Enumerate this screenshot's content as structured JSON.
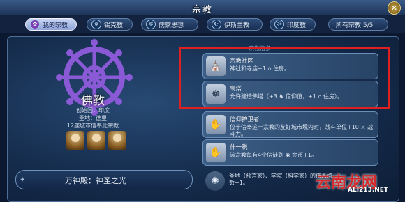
{
  "window": {
    "title": "宗教",
    "close_glyph": "✕"
  },
  "tabs": [
    {
      "label": "我的宗教",
      "icon": "lotus-icon",
      "glyph": "✿"
    },
    {
      "label": "锡克教",
      "icon": "khanda-icon",
      "glyph": "☬"
    },
    {
      "label": "儒家思想",
      "icon": "tree-icon",
      "glyph": "✲"
    },
    {
      "label": "伊斯兰教",
      "icon": "crescent-icon",
      "glyph": "☪"
    },
    {
      "label": "印度教",
      "icon": "om-icon",
      "glyph": "ॐ"
    },
    {
      "label": "所有宗教 5/5",
      "icon": "",
      "glyph": ""
    }
  ],
  "religion": {
    "name": "佛教",
    "founder": "创始国：印度",
    "holy_city": "圣地：德里",
    "cities_count": "12座城市信奉此宗教"
  },
  "beliefs_header": "宗教信条",
  "beliefs": [
    {
      "name": "宗教社区",
      "desc": "神社和寺庙+1 ⌂ 住房。",
      "glyph": "⛪"
    },
    {
      "name": "宝塔",
      "desc": "允许建造佛塔（+3 ♞ 信仰值，+1 ⌂ 住房）。",
      "glyph": "☸"
    },
    {
      "name": "信仰护卫者",
      "desc": "位于信奉这一宗教的友好城市境内时，战斗单位+10 ⚔ 战斗力。",
      "glyph": "✋"
    },
    {
      "name": "什一税",
      "desc": "该宗教每有4个信徒到 ◉ 金币+1。",
      "glyph": "✋"
    },
    {
      "name": "",
      "desc": "圣地（预言家）、学院（科学家）的伟人点数+1。",
      "glyph": "✺"
    }
  ],
  "bottom": {
    "label": "万神殿：神圣之光"
  },
  "watermark": {
    "cn": "云南龙网",
    "en": "ALI213.NET"
  },
  "colors": {
    "highlight": "#e02020",
    "accent": "#7a3fb4"
  }
}
